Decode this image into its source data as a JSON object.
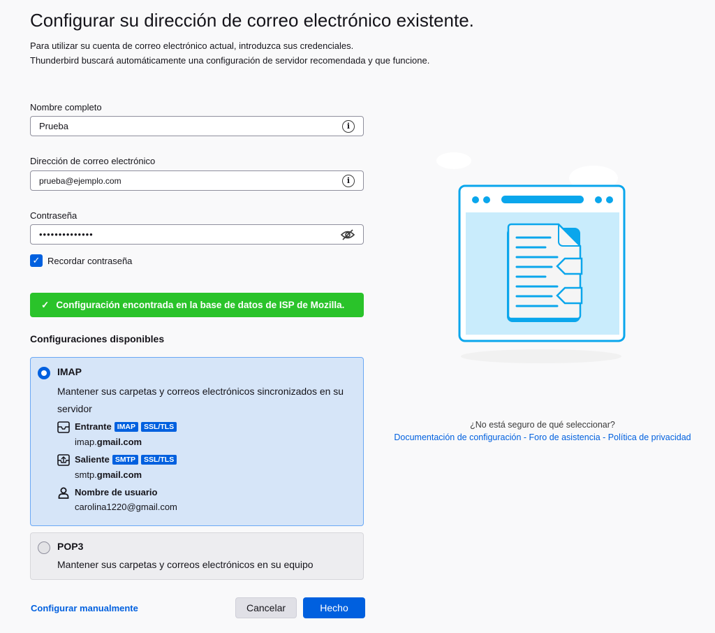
{
  "title": "Configurar su dirección de correo electrónico existente.",
  "subtitle": [
    "Para utilizar su cuenta de correo electrónico actual, introduzca sus credenciales.",
    "Thunderbird buscará automáticamente una configuración de servidor recomendada y que funcione."
  ],
  "fields": {
    "name_label": "Nombre completo",
    "name_value": "Prueba",
    "email_label": "Dirección de correo electrónico",
    "email_value": "prueba@ejemplo.com",
    "password_label": "Contraseña",
    "password_value": "••••••••••••••"
  },
  "remember_label": "Recordar contraseña",
  "banner": "Configuración encontrada en la base de datos de ISP de Mozilla.",
  "configs_heading": "Configuraciones disponibles",
  "imap": {
    "title": "IMAP",
    "desc": "Mantener sus carpetas y correos electrónicos sincronizados en su servidor",
    "incoming_label": "Entrante",
    "incoming_badges": [
      "IMAP",
      "SSL/TLS"
    ],
    "incoming_host_prefix": "imap.",
    "incoming_host_domain": "gmail.com",
    "outgoing_label": "Saliente",
    "outgoing_badges": [
      "SMTP",
      "SSL/TLS"
    ],
    "outgoing_host_prefix": "smtp.",
    "outgoing_host_domain": "gmail.com",
    "username_label": "Nombre de usuario",
    "username": "carolina1220@gmail.com"
  },
  "pop3": {
    "title": "POP3",
    "desc": "Mantener sus carpetas y correos electrónicos en su equipo"
  },
  "manual_link": "Configurar manualmente",
  "cancel": "Cancelar",
  "done": "Hecho",
  "help": {
    "question": "¿No está seguro de qué seleccionar?",
    "links": [
      "Documentación de configuración",
      "Foro de asistencia",
      "Política de privacidad"
    ],
    "sep": " - "
  }
}
